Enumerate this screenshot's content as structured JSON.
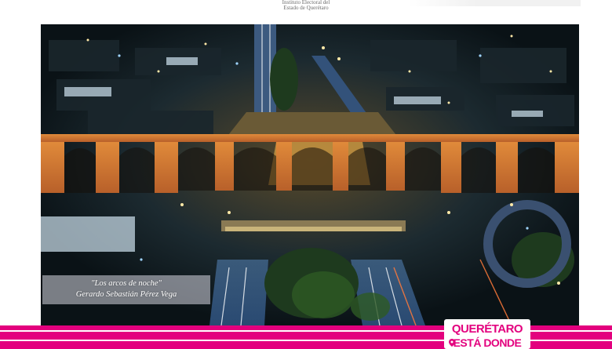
{
  "header": {
    "institution_line1": "Instituto Electoral del",
    "institution_line2": "Estado de Querétaro"
  },
  "photo": {
    "caption_title": "\"Los arcos de noche\"",
    "caption_author": "Gerardo Sebastián Pérez Vega"
  },
  "footer": {
    "brand_line1": "QUERÉTARO",
    "brand_line2": "ESTÁ DONDE",
    "brand_color": "#e3007e"
  }
}
